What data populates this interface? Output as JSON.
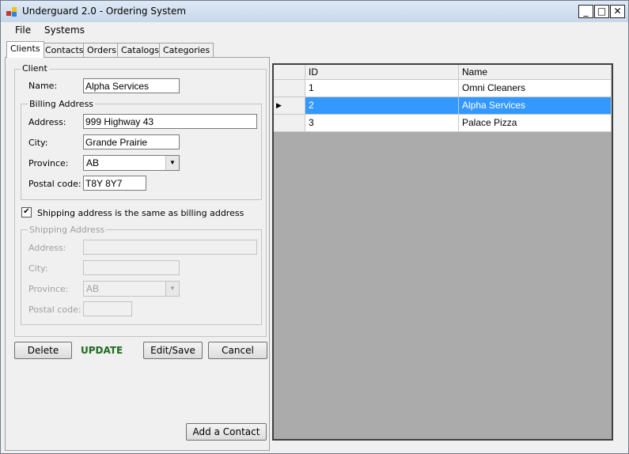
{
  "window": {
    "title": "Underguard 2.0 - Ordering System",
    "minimize_glyph": "_",
    "maximize_glyph": "□",
    "close_glyph": "✕"
  },
  "menu": {
    "file": "File",
    "systems": "Systems"
  },
  "tabs": [
    {
      "label": "Clients"
    },
    {
      "label": "Contacts"
    },
    {
      "label": "Orders"
    },
    {
      "label": "Catalogs"
    },
    {
      "label": "Categories"
    }
  ],
  "client_form": {
    "group_label": "Client",
    "name_label": "Name:",
    "name_value": "Alpha Services",
    "billing": {
      "group_label": "Billing Address",
      "address_label": "Address:",
      "address_value": "999 Highway 43",
      "city_label": "City:",
      "city_value": "Grande Prairie",
      "province_label": "Province:",
      "province_value": "AB",
      "postal_label": "Postal code:",
      "postal_value": "T8Y 8Y7"
    },
    "same_address_label": "Shipping address is the same as billing address",
    "same_address_checked": true,
    "shipping": {
      "group_label": "Shipping Address",
      "address_label": "Address:",
      "address_value": "",
      "city_label": "City:",
      "city_value": "",
      "province_label": "Province:",
      "province_value": "AB",
      "postal_label": "Postal code:",
      "postal_value": ""
    }
  },
  "buttons": {
    "delete": "Delete",
    "mode": "UPDATE",
    "edit_save": "Edit/Save",
    "cancel": "Cancel",
    "add_contact": "Add a Contact"
  },
  "grid": {
    "columns": [
      "ID",
      "Name"
    ],
    "rows": [
      {
        "id": "1",
        "name": "Omni Cleaners",
        "selected": false
      },
      {
        "id": "2",
        "name": "Alpha Services",
        "selected": true
      },
      {
        "id": "3",
        "name": "Palace Pizza",
        "selected": false
      }
    ]
  },
  "colors": {
    "selection": "#3399ff",
    "mode_text": "#1e6b1e",
    "grid_background": "#ababab"
  }
}
